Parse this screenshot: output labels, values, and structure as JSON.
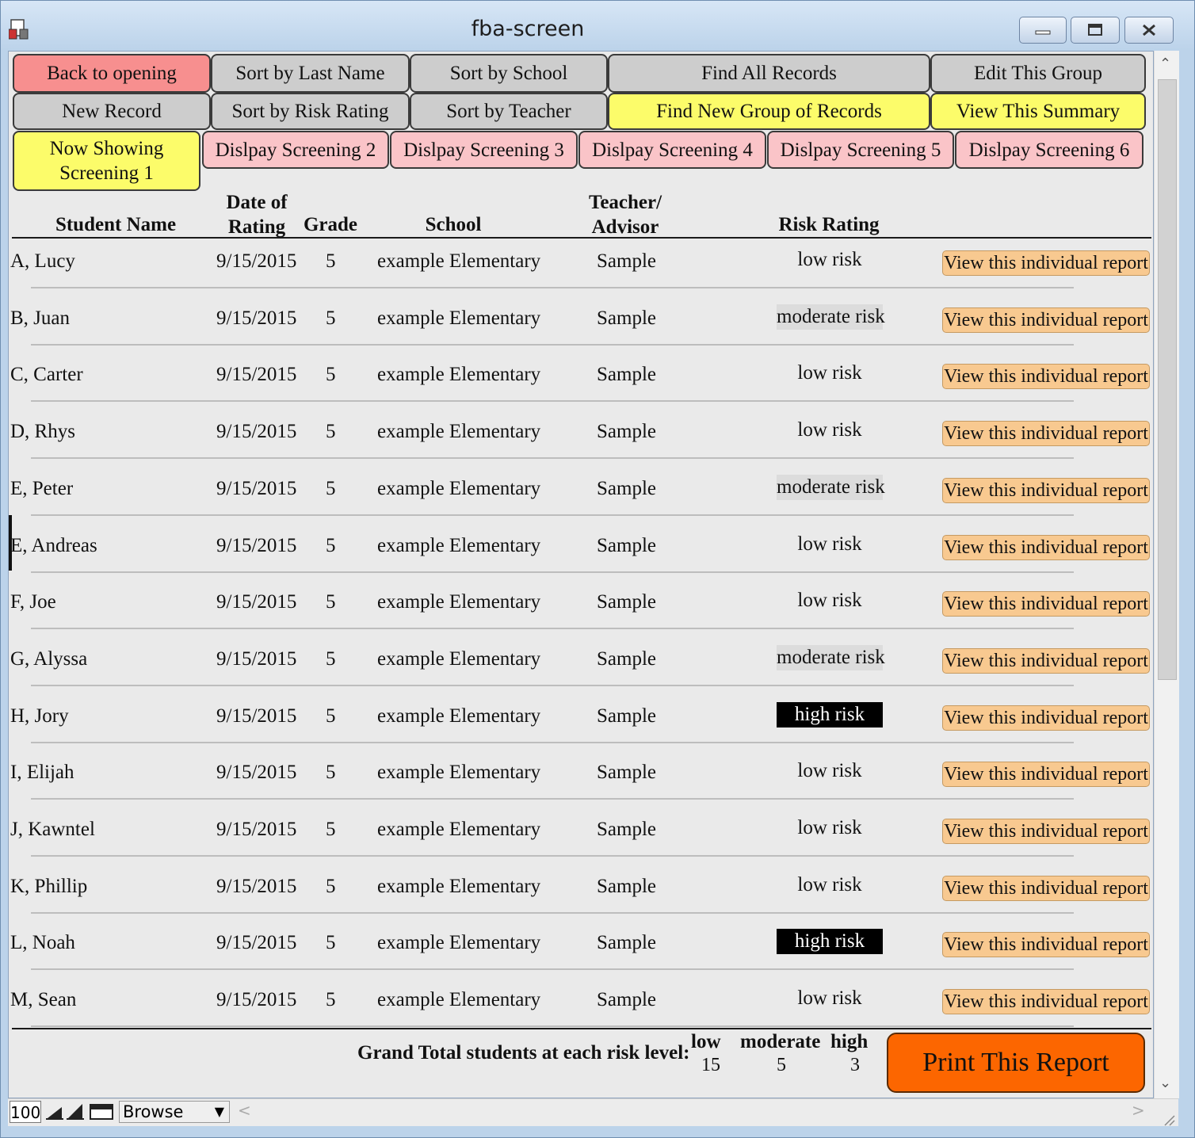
{
  "window": {
    "title": "fba-screen"
  },
  "toolbar": {
    "row1": [
      {
        "label": "Back to opening",
        "style": "red"
      },
      {
        "label": "Sort by Last Name",
        "style": "gray"
      },
      {
        "label": "Sort by School",
        "style": "gray"
      },
      {
        "label": "Find All Records",
        "style": "gray"
      },
      {
        "label": "Edit This Group",
        "style": "gray"
      }
    ],
    "row2": [
      {
        "label": "New Record",
        "style": "gray"
      },
      {
        "label": "Sort by Risk Rating",
        "style": "gray"
      },
      {
        "label": "Sort by Teacher",
        "style": "gray"
      },
      {
        "label": "Find New Group of Records",
        "style": "yellow"
      },
      {
        "label": "View This Summary",
        "style": "yellow"
      }
    ],
    "screenings": [
      {
        "label": "Now Showing Screening 1",
        "style": "yellow"
      },
      {
        "label": "Dislpay Screening 2",
        "style": "pink"
      },
      {
        "label": "Dislpay Screening 3",
        "style": "pink"
      },
      {
        "label": "Dislpay Screening 4",
        "style": "pink"
      },
      {
        "label": "Dislpay Screening 5",
        "style": "pink"
      },
      {
        "label": "Dislpay Screening 6",
        "style": "pink"
      }
    ]
  },
  "columns": {
    "student_name": "Student Name",
    "date_of_rating_1": "Date of",
    "date_of_rating_2": "Rating",
    "grade": "Grade",
    "school": "School",
    "teacher_1": "Teacher/",
    "teacher_2": "Advisor",
    "risk_rating": "Risk Rating"
  },
  "report_button_label": "View this individual report",
  "rows": [
    {
      "name": "A, Lucy",
      "date": "9/15/2015",
      "grade": "5",
      "school": "example Elementary",
      "teacher": "Sample",
      "risk": "low risk",
      "level": "low"
    },
    {
      "name": "B, Juan",
      "date": "9/15/2015",
      "grade": "5",
      "school": "example Elementary",
      "teacher": "Sample",
      "risk": "moderate risk",
      "level": "moderate"
    },
    {
      "name": "C, Carter",
      "date": "9/15/2015",
      "grade": "5",
      "school": "example Elementary",
      "teacher": "Sample",
      "risk": "low risk",
      "level": "low"
    },
    {
      "name": "D, Rhys",
      "date": "9/15/2015",
      "grade": "5",
      "school": "example Elementary",
      "teacher": "Sample",
      "risk": "low risk",
      "level": "low"
    },
    {
      "name": "E, Peter",
      "date": "9/15/2015",
      "grade": "5",
      "school": "example Elementary",
      "teacher": "Sample",
      "risk": "moderate risk",
      "level": "moderate"
    },
    {
      "name": "E, Andreas",
      "date": "9/15/2015",
      "grade": "5",
      "school": "example Elementary",
      "teacher": "Sample",
      "risk": "low risk",
      "level": "low"
    },
    {
      "name": "F, Joe",
      "date": "9/15/2015",
      "grade": "5",
      "school": "example Elementary",
      "teacher": "Sample",
      "risk": "low risk",
      "level": "low"
    },
    {
      "name": "G, Alyssa",
      "date": "9/15/2015",
      "grade": "5",
      "school": "example Elementary",
      "teacher": "Sample",
      "risk": "moderate risk",
      "level": "moderate"
    },
    {
      "name": "H, Jory",
      "date": "9/15/2015",
      "grade": "5",
      "school": "example Elementary",
      "teacher": "Sample",
      "risk": "high risk",
      "level": "high"
    },
    {
      "name": "I, Elijah",
      "date": "9/15/2015",
      "grade": "5",
      "school": "example Elementary",
      "teacher": "Sample",
      "risk": "low risk",
      "level": "low"
    },
    {
      "name": "J, Kawntel",
      "date": "9/15/2015",
      "grade": "5",
      "school": "example Elementary",
      "teacher": "Sample",
      "risk": "low risk",
      "level": "low"
    },
    {
      "name": "K, Phillip",
      "date": "9/15/2015",
      "grade": "5",
      "school": "example Elementary",
      "teacher": "Sample",
      "risk": "low risk",
      "level": "low"
    },
    {
      "name": "L, Noah",
      "date": "9/15/2015",
      "grade": "5",
      "school": "example Elementary",
      "teacher": "Sample",
      "risk": "high risk",
      "level": "high"
    },
    {
      "name": "M, Sean",
      "date": "9/15/2015",
      "grade": "5",
      "school": "example Elementary",
      "teacher": "Sample",
      "risk": "low risk",
      "level": "low"
    }
  ],
  "summary": {
    "label": "Grand Total students at each risk level:",
    "low_label": "low",
    "low_value": "15",
    "moderate_label": "moderate",
    "moderate_value": "5",
    "high_label": "high",
    "high_value": "3"
  },
  "print_button": "Print This Report",
  "statusbar": {
    "zoom": "100",
    "mode": "Browse"
  },
  "colors": {
    "red": "#f78f8f",
    "gray": "#cdcdcd",
    "yellow": "#fcfc6a",
    "pink": "#fac4c8",
    "report": "#f8c990",
    "print": "#fc6600"
  }
}
